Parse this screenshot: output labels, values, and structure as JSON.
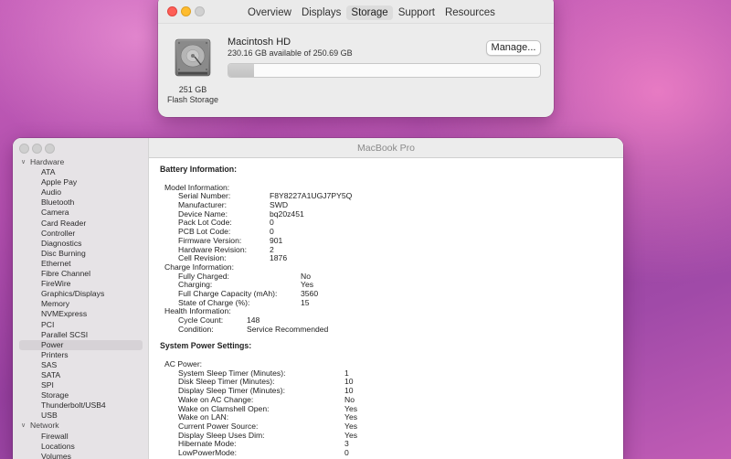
{
  "about": {
    "tabs": [
      {
        "label": "Overview",
        "active": false
      },
      {
        "label": "Displays",
        "active": false
      },
      {
        "label": "Storage",
        "active": true
      },
      {
        "label": "Support",
        "active": false
      },
      {
        "label": "Resources",
        "active": false
      }
    ],
    "disk_icon": "hard-drive-icon",
    "disk_size": "251 GB",
    "disk_type": "Flash Storage",
    "volume_name": "Macintosh HD",
    "available_text": "230.16 GB available of 250.69 GB",
    "manage_label": "Manage...",
    "used_fraction": 0.082
  },
  "sysinfo": {
    "window_title": "MacBook Pro",
    "sidebar": [
      {
        "label": "Hardware",
        "group": true
      },
      {
        "label": "ATA"
      },
      {
        "label": "Apple Pay"
      },
      {
        "label": "Audio"
      },
      {
        "label": "Bluetooth"
      },
      {
        "label": "Camera"
      },
      {
        "label": "Card Reader"
      },
      {
        "label": "Controller"
      },
      {
        "label": "Diagnostics"
      },
      {
        "label": "Disc Burning"
      },
      {
        "label": "Ethernet"
      },
      {
        "label": "Fibre Channel"
      },
      {
        "label": "FireWire"
      },
      {
        "label": "Graphics/Displays"
      },
      {
        "label": "Memory"
      },
      {
        "label": "NVMExpress"
      },
      {
        "label": "PCI"
      },
      {
        "label": "Parallel SCSI"
      },
      {
        "label": "Power",
        "selected": true
      },
      {
        "label": "Printers"
      },
      {
        "label": "SAS"
      },
      {
        "label": "SATA"
      },
      {
        "label": "SPI"
      },
      {
        "label": "Storage"
      },
      {
        "label": "Thunderbolt/USB4"
      },
      {
        "label": "USB"
      },
      {
        "label": "Network",
        "group": true
      },
      {
        "label": "Firewall"
      },
      {
        "label": "Locations"
      },
      {
        "label": "Volumes"
      }
    ],
    "battery_title": "Battery Information:",
    "battery_lines": [
      {
        "key": "",
        "value": ""
      },
      {
        "key": "Model Information:",
        "value": "",
        "level": 0
      },
      {
        "key": "Serial Number:",
        "value": "F8Y8227A1UGJ7PY5Q",
        "level": 1,
        "col": "a"
      },
      {
        "key": "Manufacturer:",
        "value": "SWD",
        "level": 1,
        "col": "a"
      },
      {
        "key": "Device Name:",
        "value": "bq20z451",
        "level": 1,
        "col": "a"
      },
      {
        "key": "Pack Lot Code:",
        "value": "0",
        "level": 1,
        "col": "a"
      },
      {
        "key": "PCB Lot Code:",
        "value": "0",
        "level": 1,
        "col": "a"
      },
      {
        "key": "Firmware Version:",
        "value": "901",
        "level": 1,
        "col": "a"
      },
      {
        "key": "Hardware Revision:",
        "value": "2",
        "level": 1,
        "col": "a"
      },
      {
        "key": "Cell Revision:",
        "value": "1876",
        "level": 1,
        "col": "a"
      },
      {
        "key": "Charge Information:",
        "value": "",
        "level": 0
      },
      {
        "key": "Fully Charged:",
        "value": "No",
        "level": 1,
        "col": "b"
      },
      {
        "key": "Charging:",
        "value": "Yes",
        "level": 1,
        "col": "b"
      },
      {
        "key": "Full Charge Capacity (mAh):",
        "value": "3560",
        "level": 1,
        "col": "b"
      },
      {
        "key": "State of Charge (%):",
        "value": "15",
        "level": 1,
        "col": "b"
      },
      {
        "key": "Health Information:",
        "value": "",
        "level": 0
      },
      {
        "key": "Cycle Count:",
        "value": "148",
        "level": 1,
        "col": "c"
      },
      {
        "key": "Condition:",
        "value": "Service Recommended",
        "level": 1,
        "col": "c"
      }
    ],
    "power_title": "System Power Settings:",
    "power_lines": [
      {
        "key": "",
        "value": ""
      },
      {
        "key": "AC Power:",
        "value": "",
        "level": 0
      },
      {
        "key": "System Sleep Timer (Minutes):",
        "value": "1",
        "level": 1,
        "col": "d"
      },
      {
        "key": "Disk Sleep Timer (Minutes):",
        "value": "10",
        "level": 1,
        "col": "d"
      },
      {
        "key": "Display Sleep Timer (Minutes):",
        "value": "10",
        "level": 1,
        "col": "d"
      },
      {
        "key": "Wake on AC Change:",
        "value": "No",
        "level": 1,
        "col": "d"
      },
      {
        "key": "Wake on Clamshell Open:",
        "value": "Yes",
        "level": 1,
        "col": "d"
      },
      {
        "key": "Wake on LAN:",
        "value": "Yes",
        "level": 1,
        "col": "d"
      },
      {
        "key": "Current Power Source:",
        "value": "Yes",
        "level": 1,
        "col": "d"
      },
      {
        "key": "Display Sleep Uses Dim:",
        "value": "Yes",
        "level": 1,
        "col": "d"
      },
      {
        "key": "Hibernate Mode:",
        "value": "3",
        "level": 1,
        "col": "d"
      },
      {
        "key": "LowPowerMode:",
        "value": "0",
        "level": 1,
        "col": "d"
      }
    ]
  }
}
